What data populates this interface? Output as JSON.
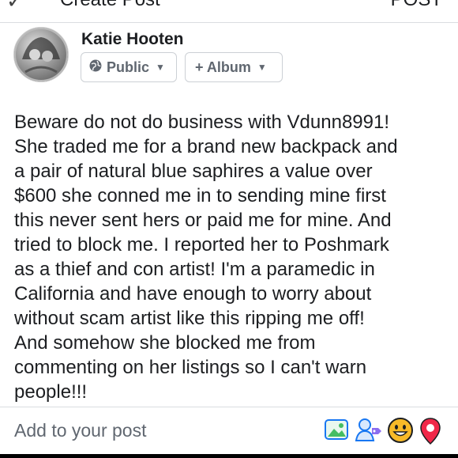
{
  "header": {
    "back_glyph": "✓",
    "title": "Create Post",
    "post_label": "POST"
  },
  "composer": {
    "author_name": "Katie Hooten",
    "privacy_label": "Public",
    "album_label": "+ Album",
    "post_text": "Beware do not do business with Vdunn8991!\nShe traded me for a brand new backpack and\na pair of natural blue saphires a value over\n$600 she conned me in to sending mine first\nthis never sent hers or paid me for mine. And\ntried to block me. I reported her to Poshmark\nas a thief and con artist! I'm a paramedic in\nCalifornia and have enough to worry about\nwithout scam artist like this ripping me off!\nAnd somehow she blocked me from\ncommenting on her listings so I can't warn\npeople!!!"
  },
  "bottom": {
    "placeholder": "Add to your post",
    "icons": [
      "photo-icon",
      "tag-people-icon",
      "feeling-icon",
      "location-icon"
    ]
  },
  "colors": {
    "text": "#1c1e21",
    "muted": "#606770",
    "border": "#ccd0d5",
    "photo_green": "#45bd62",
    "tag_blue": "#1877f2",
    "feeling_yellow": "#f7b928",
    "location_red": "#f02849"
  }
}
